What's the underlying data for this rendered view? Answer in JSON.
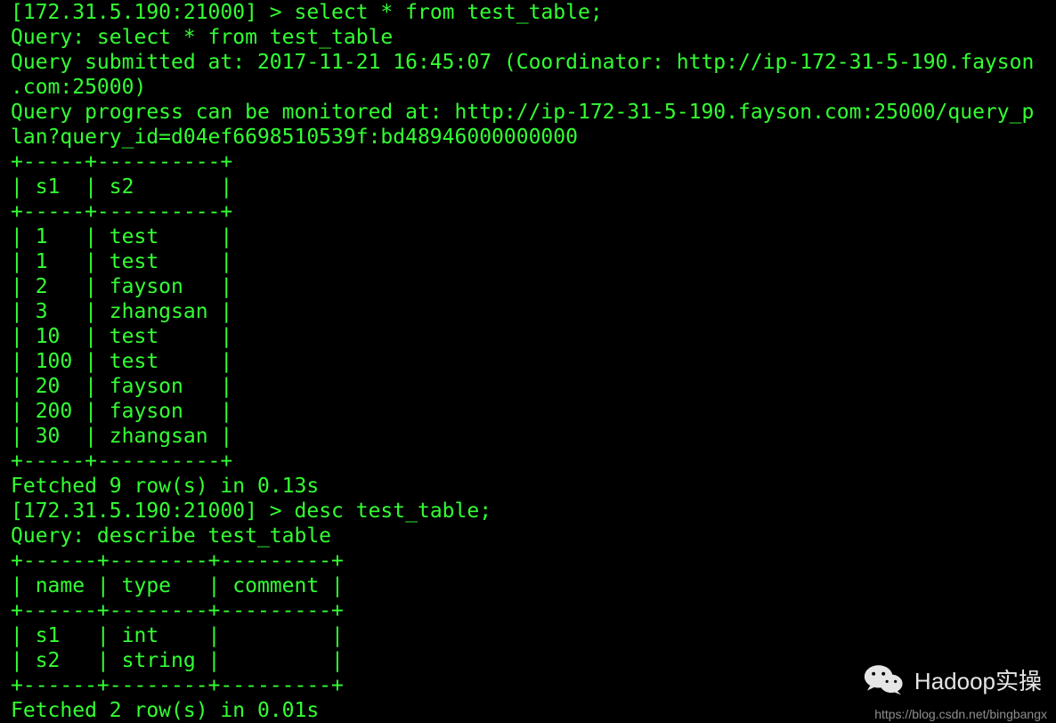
{
  "prompt_host": "[172.31.5.190:21000]",
  "prompt_sep": " > ",
  "cmd1": "select * from test_table;",
  "query1_echo": "Query: select * from test_table",
  "query1_submitted": "Query submitted at: 2017-11-21 16:45:07 (Coordinator: http://ip-172-31-5-190.fayson.com:25000)",
  "query1_progress": "Query progress can be monitored at: http://ip-172-31-5-190.fayson.com:25000/query_plan?query_id=d04ef6698510539f:bd48946000000000",
  "table1": {
    "border": "+-----+----------+",
    "header": "| s1  | s2       |",
    "rows": [
      "| 1   | test     |",
      "| 1   | test     |",
      "| 2   | fayson   |",
      "| 3   | zhangsan |",
      "| 10  | test     |",
      "| 100 | test     |",
      "| 20  | fayson   |",
      "| 200 | fayson   |",
      "| 30  | zhangsan |"
    ]
  },
  "fetched1": "Fetched 9 row(s) in 0.13s",
  "cmd2": "desc test_table;",
  "query2_echo": "Query: describe test_table",
  "table2": {
    "border": "+------+--------+---------+",
    "header": "| name | type   | comment |",
    "rows": [
      "| s1   | int    |         |",
      "| s2   | string |         |"
    ]
  },
  "fetched2": "Fetched 2 row(s) in 0.01s",
  "watermark_text": "Hadoop实操",
  "attribution": "https://blog.csdn.net/bingbangx"
}
